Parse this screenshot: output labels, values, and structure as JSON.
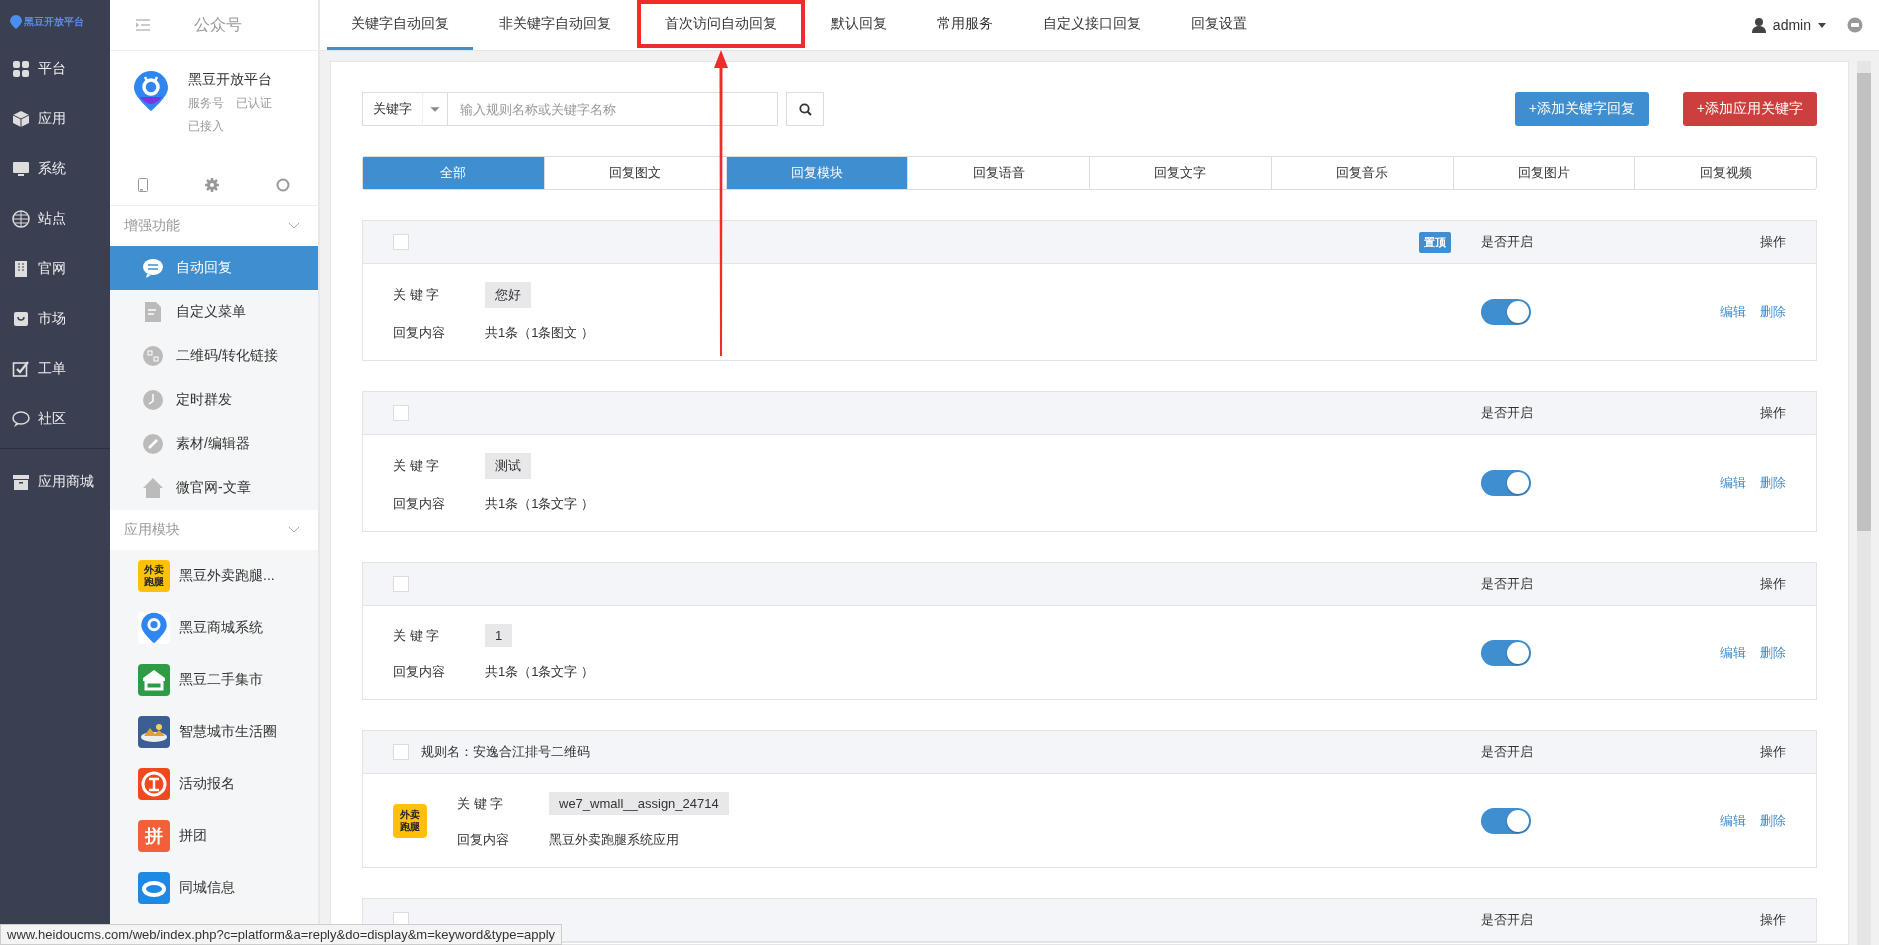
{
  "logo": {
    "text": "黑豆开放平台"
  },
  "nav_rail": [
    {
      "label": "平台"
    },
    {
      "label": "应用"
    },
    {
      "label": "系统"
    },
    {
      "label": "站点"
    },
    {
      "label": "官网"
    },
    {
      "label": "市场"
    },
    {
      "label": "工单"
    },
    {
      "label": "社区"
    },
    {
      "label": "应用商城"
    }
  ],
  "panel": {
    "title": "公众号",
    "account": {
      "name": "黑豆开放平台",
      "type": "服务号",
      "verified": "已认证",
      "status": "已接入"
    },
    "groups": [
      {
        "title": "增强功能",
        "expanded": true,
        "items": [
          {
            "label": "自动回复",
            "selected": true
          },
          {
            "label": "自定义菜单",
            "selected": false
          },
          {
            "label": "二维码/转化链接",
            "selected": false
          },
          {
            "label": "定时群发",
            "selected": false
          },
          {
            "label": "素材/编辑器",
            "selected": false
          },
          {
            "label": "微官网-文章",
            "selected": false
          }
        ]
      },
      {
        "title": "应用模块",
        "expanded": true,
        "apps": [
          {
            "label": "黑豆外卖跑腿...",
            "color": "#ffc107",
            "icon_text": "外卖跑腿"
          },
          {
            "label": "黑豆商城系统",
            "color": "#ffffff"
          },
          {
            "label": "黑豆二手集市",
            "color": "#2e9b45"
          },
          {
            "label": "智慧城市生活圈",
            "color": "#3b5f95"
          },
          {
            "label": "活动报名",
            "color": "#f04a1c"
          },
          {
            "label": "拼团",
            "color": "#f2603a",
            "icon_text": "拼"
          },
          {
            "label": "同城信息",
            "color": "#1e88e5"
          }
        ]
      }
    ]
  },
  "tabs": [
    {
      "label": "关键字自动回复",
      "selected": true,
      "highlighted": false
    },
    {
      "label": "非关键字自动回复",
      "selected": false,
      "highlighted": false
    },
    {
      "label": "首次访问自动回复",
      "selected": false,
      "highlighted": true
    },
    {
      "label": "默认回复",
      "selected": false,
      "highlighted": false
    },
    {
      "label": "常用服务",
      "selected": false,
      "highlighted": false
    },
    {
      "label": "自定义接口回复",
      "selected": false,
      "highlighted": false
    },
    {
      "label": "回复设置",
      "selected": false,
      "highlighted": false
    }
  ],
  "user": {
    "name": "admin"
  },
  "search": {
    "scope": "关键字",
    "placeholder": "输入规则名称或关键字名称"
  },
  "actions": [
    {
      "label": "+添加关键字回复",
      "kind": "primary"
    },
    {
      "label": "+添加应用关键字",
      "kind": "danger"
    }
  ],
  "filters": [
    {
      "label": "全部",
      "selected": true
    },
    {
      "label": "回复图文",
      "selected": false
    },
    {
      "label": "回复模块",
      "selected": true
    },
    {
      "label": "回复语音",
      "selected": false
    },
    {
      "label": "回复文字",
      "selected": false
    },
    {
      "label": "回复音乐",
      "selected": false
    },
    {
      "label": "回复图片",
      "selected": false
    },
    {
      "label": "回复视频",
      "selected": false
    }
  ],
  "rules": [
    {
      "badge": "置顶",
      "status_header": "是否开启",
      "ops_header": "操作",
      "checked": false,
      "keyword_label": "关 键 字",
      "keyword": "您好",
      "content_label": "回复内容",
      "content": "共1条（1条图文 ）",
      "on": true,
      "edit": "编辑",
      "delete": "删除"
    },
    {
      "status_header": "是否开启",
      "ops_header": "操作",
      "checked": false,
      "keyword_label": "关 键 字",
      "keyword": "测试",
      "content_label": "回复内容",
      "content": "共1条（1条文字 ）",
      "on": true,
      "edit": "编辑",
      "delete": "删除"
    },
    {
      "status_header": "是否开启",
      "ops_header": "操作",
      "checked": false,
      "keyword_label": "关 键 字",
      "keyword": "1",
      "content_label": "回复内容",
      "content": "共1条（1条文字 ）",
      "on": true,
      "edit": "编辑",
      "delete": "删除"
    },
    {
      "title": "规则名：安逸合江排号二维码",
      "status_header": "是否开启",
      "ops_header": "操作",
      "checked": false,
      "app_icon_text": "外卖跑腿",
      "keyword_label": "关 键 字",
      "keyword": "we7_wmall__assign_24714",
      "content_label": "回复内容",
      "content": "黑豆外卖跑腿系统应用",
      "on": true,
      "edit": "编辑",
      "delete": "删除"
    },
    {
      "status_header": "是否开启",
      "ops_header": "操作",
      "checked": false
    }
  ],
  "status_url": "www.heidoucms.com/web/index.php?c=platform&a=reply&do=display&m=keyword&type=apply"
}
